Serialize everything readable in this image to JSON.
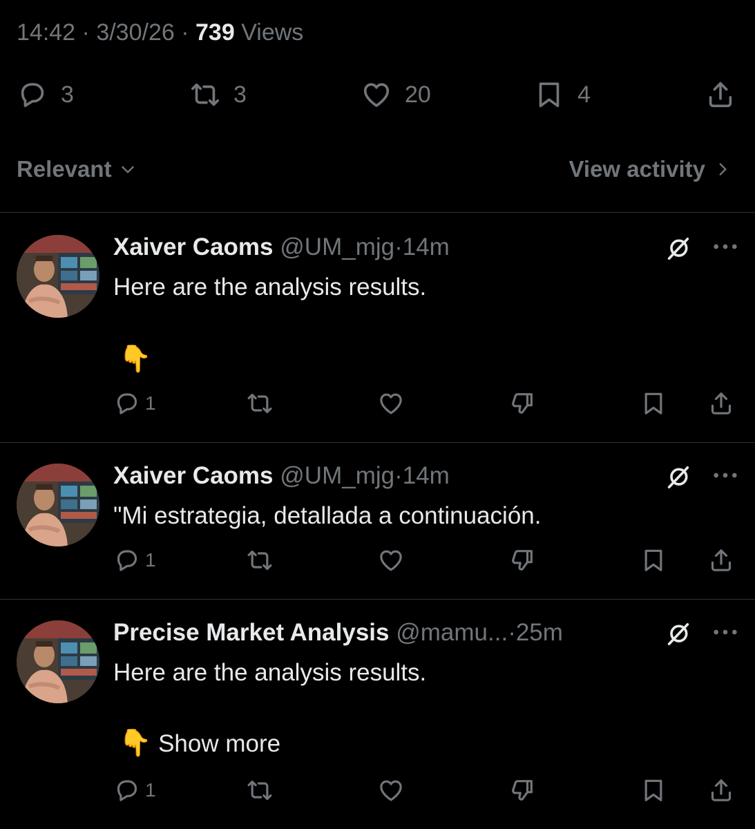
{
  "meta": {
    "time": "14:42",
    "date": "3/30/26",
    "views_count": "739",
    "views_label": "Views",
    "sep": "·"
  },
  "main_actions": {
    "replies": "3",
    "reposts": "3",
    "likes": "20",
    "bookmarks": "4"
  },
  "sort": {
    "label": "Relevant",
    "view_activity": "View activity"
  },
  "replies": [
    {
      "name": "Xaiver Caoms",
      "handle": "@UM_mjg",
      "time": "14m",
      "text": "Here are the analysis results.",
      "emoji": "👇",
      "show_more": "",
      "reply_count": "1"
    },
    {
      "name": "Xaiver Caoms",
      "handle": "@UM_mjg",
      "time": "14m",
      "text": "\"Mi estrategia, detallada a continuación.",
      "emoji": "",
      "show_more": "",
      "reply_count": "1"
    },
    {
      "name": "Precise Market Analysis",
      "handle": "@mamu...",
      "time": "25m",
      "text": "Here are the analysis results.",
      "emoji": "👇",
      "show_more": "Show more",
      "reply_count": "1"
    }
  ],
  "colors": {
    "background": "#000000",
    "text": "#e7e9ea",
    "muted": "#71767b",
    "divider": "#2f3336"
  }
}
